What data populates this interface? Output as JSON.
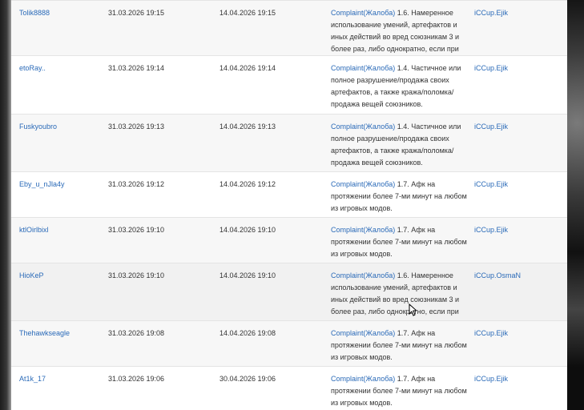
{
  "rows": [
    {
      "player": "Tolik8888",
      "date_from": "31.03.2026 19:15",
      "date_to": "14.04.2026 19:15",
      "reason_link": "Complaint(Жалоба)",
      "reason_text": " 1.6. Намеренное использование умений, артефактов и иных действий во вред союзникам 3 и более раз, либо однократно, если при",
      "admin": "iCCup.Ejik"
    },
    {
      "player": "etoRay..",
      "date_from": "31.03.2026 19:14",
      "date_to": "14.04.2026 19:14",
      "reason_link": "Complaint(Жалоба)",
      "reason_text": " 1.4. Частичное или полное разрушение/продажа своих артефактов, а также кража/поломка/продажа вещей союзников.",
      "admin": "iCCup.Ejik"
    },
    {
      "player": "Fuskyoubro",
      "date_from": "31.03.2026 19:13",
      "date_to": "14.04.2026 19:13",
      "reason_link": "Complaint(Жалоба)",
      "reason_text": " 1.4. Частичное или полное разрушение/продажа своих артефактов, а также кража/поломка/продажа вещей союзников.",
      "admin": "iCCup.Ejik"
    },
    {
      "player": "Eby_u_nJla4y",
      "date_from": "31.03.2026 19:12",
      "date_to": "14.04.2026 19:12",
      "reason_link": "Complaint(Жалоба)",
      "reason_text": " 1.7. Афк на протяжении более 7-ми минут на любом из игровых модов.",
      "admin": "iCCup.Ejik"
    },
    {
      "player": "ktlOirlbixl",
      "date_from": "31.03.2026 19:10",
      "date_to": "14.04.2026 19:10",
      "reason_link": "Complaint(Жалоба)",
      "reason_text": " 1.7. Афк на протяжении более 7-ми минут на любом из игровых модов.",
      "admin": "iCCup.Ejik"
    },
    {
      "player": "HioKeP",
      "date_from": "31.03.2026 19:10",
      "date_to": "14.04.2026 19:10",
      "reason_link": "Complaint(Жалоба)",
      "reason_text": " 1.6. Намеренное использование умений, артефактов и иных действий во вред союзникам 3 и более раз, либо однократно, если при",
      "admin": "iCCup.OsmaN"
    },
    {
      "player": "Thehawkseagle",
      "date_from": "31.03.2026 19:08",
      "date_to": "14.04.2026 19:08",
      "reason_link": "Complaint(Жалоба)",
      "reason_text": " 1.7. Афк на протяжении более 7-ми минут на любом из игровых модов.",
      "admin": "iCCup.Ejik"
    },
    {
      "player": "At1k_17",
      "date_from": "31.03.2026 19:06",
      "date_to": "30.04.2026 19:06",
      "reason_link": "Complaint(Жалоба)",
      "reason_text": " 1.7. Афк на протяжении более 7-ми минут на любом из игровых модов.",
      "admin": "iCCup.Ejik"
    }
  ],
  "icons": {
    "cursor": "mouse-pointer-icon"
  },
  "colors": {
    "link": "#2a6ab8",
    "text": "#333333",
    "row_alt": "#f7f7f7",
    "border": "#e4e4e4"
  }
}
